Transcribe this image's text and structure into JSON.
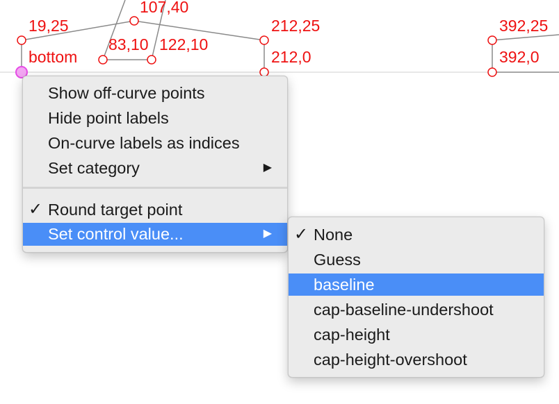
{
  "canvas": {
    "point_labels": [
      "19,25",
      "107,40",
      "212,25",
      "392,25",
      "bottom",
      "83,10",
      "122,10",
      "212,0",
      "392,0"
    ]
  },
  "context_menu": {
    "items": [
      {
        "label": "Show off-curve points"
      },
      {
        "label": "Hide point labels"
      },
      {
        "label": "On-curve labels as indices"
      },
      {
        "label": "Set category",
        "arrow": "▶"
      },
      {
        "label": "Round target point",
        "check": "✓"
      },
      {
        "label": "Set control value...",
        "arrow": "▶"
      }
    ]
  },
  "submenu": {
    "items": [
      {
        "label": "None",
        "check": "✓"
      },
      {
        "label": "Guess"
      },
      {
        "label": "baseline"
      },
      {
        "label": "cap-baseline-undershoot"
      },
      {
        "label": "cap-height"
      },
      {
        "label": "cap-height-overshoot"
      }
    ]
  },
  "colors": {
    "point": "#ee1111",
    "outline": "#8a8a8a",
    "selected_point": "#e64ce6",
    "highlight": "#4a8ef7",
    "menu_bg": "#ebebeb"
  }
}
